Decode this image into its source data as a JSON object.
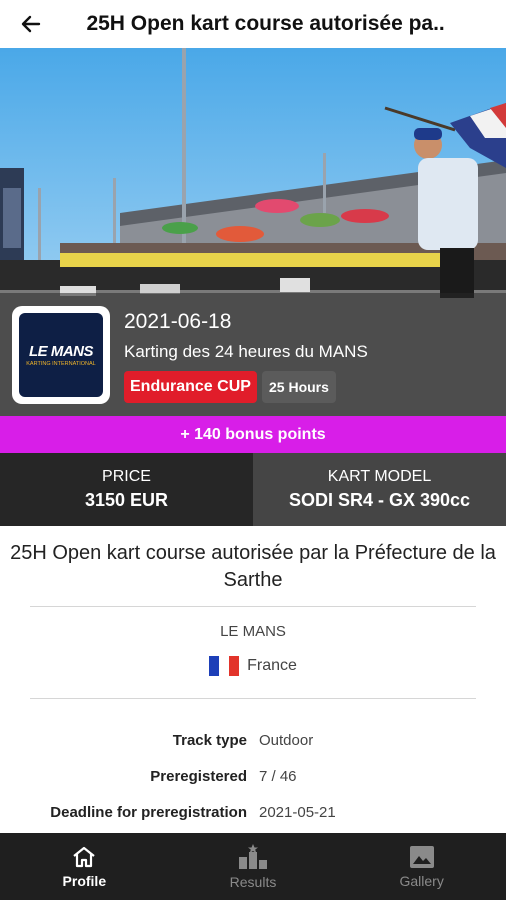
{
  "app_bar": {
    "title": "25H Open kart course autorisée pa.."
  },
  "event": {
    "date": "2021-06-18",
    "track": "Karting des 24 heures du MANS",
    "badges": {
      "category": "Endurance CUP",
      "duration": "25 Hours"
    },
    "logo": {
      "text": "LE MANS",
      "subtext": "KARTING INTERNATIONAL"
    }
  },
  "bonus": {
    "text": "+ 140 bonus points"
  },
  "info": {
    "price_label": "PRICE",
    "price_value": "3150 EUR",
    "kart_label": "KART MODEL",
    "kart_value": "SODI SR4 - GX 390cc"
  },
  "description": "25H Open kart course autorisée par la Préfecture de la Sarthe",
  "location": {
    "city": "LE MANS",
    "country": "France"
  },
  "details": [
    {
      "label": "Track type",
      "value": "Outdoor"
    },
    {
      "label": "Preregistered",
      "value": "7 / 46"
    },
    {
      "label": "Deadline for preregistration",
      "value": "2021-05-21"
    }
  ],
  "bottom_nav": [
    {
      "label": "Profile",
      "icon": "home-icon",
      "active": true
    },
    {
      "label": "Results",
      "icon": "podium-icon",
      "active": false
    },
    {
      "label": "Gallery",
      "icon": "image-icon",
      "active": false
    }
  ],
  "colors": {
    "bonus": "#d81ee8",
    "badge_red": "#e11d2a",
    "badge_gray": "#5b5b5b",
    "nav_bg": "#1f1f1f"
  }
}
